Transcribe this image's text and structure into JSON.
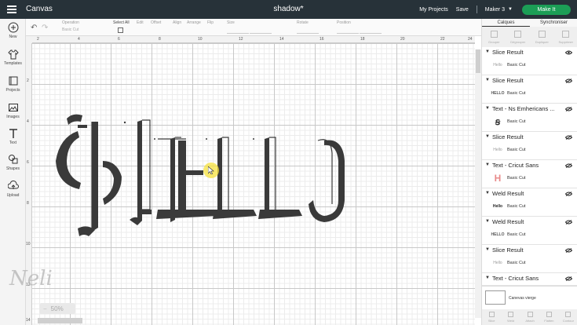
{
  "header": {
    "app_name": "Canvas",
    "doc_title": "shadow*",
    "my_projects": "My Projects",
    "save": "Save",
    "machine": "Maker 3",
    "make_it": "Make It"
  },
  "sidebar": {
    "items": [
      {
        "label": "New",
        "icon": "plus-icon"
      },
      {
        "label": "Templates",
        "icon": "shirt-icon"
      },
      {
        "label": "Projects",
        "icon": "projects-icon"
      },
      {
        "label": "Images",
        "icon": "image-icon"
      },
      {
        "label": "Text",
        "icon": "text-icon"
      },
      {
        "label": "Shapes",
        "icon": "shapes-icon"
      },
      {
        "label": "Upload",
        "icon": "upload-icon"
      }
    ]
  },
  "toolbar": {
    "operation_title": "Operation",
    "operation_value": "Basic Cut",
    "select_all": "Select All",
    "edit": "Edit",
    "offset": "Offset",
    "align": "Align",
    "arrange": "Arrange",
    "flip": "Flip",
    "size": "Size",
    "rotate": "Rotate",
    "position": "Position"
  },
  "rulers": {
    "top": [
      "2",
      "4",
      "6",
      "8",
      "10",
      "12",
      "14",
      "16",
      "18",
      "20",
      "22",
      "24"
    ],
    "left": [
      "2",
      "4",
      "6",
      "8",
      "10",
      "12",
      "14"
    ]
  },
  "canvas": {
    "design_text": "HELLO",
    "watermark": "Neli",
    "zoom": "50%",
    "zoom_minus": "−"
  },
  "panel": {
    "tabs": [
      "Calques",
      "Synchroniser"
    ],
    "tools": [
      "Grouper",
      "Dégrouper",
      "Dupliquer",
      "Supprimer"
    ],
    "layers": [
      {
        "name": "Slice Result",
        "cut": "Basic Cut",
        "thumb": "Hello",
        "visible": true
      },
      {
        "name": "Slice Result",
        "cut": "Basic Cut",
        "thumb": "HELLO",
        "visible": false
      },
      {
        "name": "Text - Ns Emhericans ...",
        "cut": "Basic Cut",
        "thumb": "ꞩ",
        "visible": false
      },
      {
        "name": "Slice Result",
        "cut": "Basic Cut",
        "thumb": "Hello",
        "visible": false
      },
      {
        "name": "Text - Cricut Sans",
        "cut": "Basic Cut",
        "thumb": "H",
        "visible": false
      },
      {
        "name": "Weld Result",
        "cut": "Basic Cut",
        "thumb": "Hello",
        "visible": false
      },
      {
        "name": "Weld Result",
        "cut": "Basic Cut",
        "thumb": "HELLO",
        "visible": false
      },
      {
        "name": "Slice Result",
        "cut": "Basic Cut",
        "thumb": "Hello",
        "visible": false
      },
      {
        "name": "Text - Cricut Sans",
        "cut": "",
        "thumb": "",
        "visible": false
      }
    ],
    "blank_canvas": "Canevas vierge",
    "bottom_tools": [
      "Slice",
      "Weld",
      "Attach",
      "Flatten",
      "Contour"
    ]
  },
  "colors": {
    "topbar": "#273239",
    "make_button": "#1c9e56",
    "design": "#3a3a3a",
    "cursor": "#f6e23e",
    "thumb_pink": "#e88a8a"
  }
}
